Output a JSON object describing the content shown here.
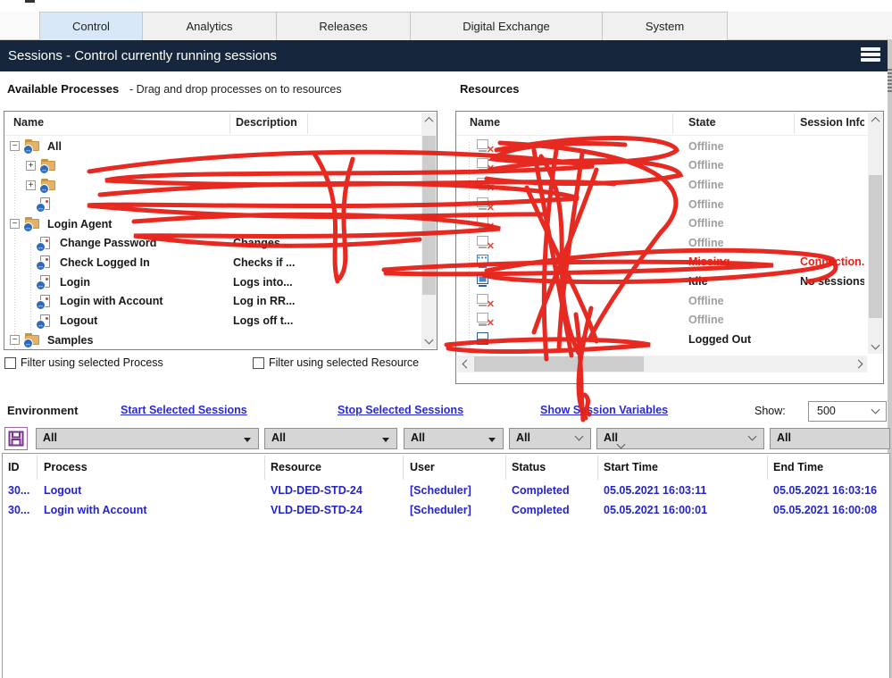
{
  "colors": {
    "header_navy": "#16263c",
    "tab_selected": "#d9e8f8",
    "link_blue": "#2a2ad4",
    "row_blue": "#2424c8",
    "missing_red": "#e62117",
    "offline_gray": "#9f9f9f",
    "scribble_red": "#e51f16"
  },
  "tabs": {
    "items": [
      {
        "label": "Control",
        "active": true
      },
      {
        "label": "Analytics",
        "active": false
      },
      {
        "label": "Releases",
        "active": false
      },
      {
        "label": "Digital Exchange",
        "active": false
      },
      {
        "label": "System",
        "active": false
      }
    ]
  },
  "header": {
    "title": "Sessions - Control currently running sessions",
    "menu_icon": "hamburger-icon"
  },
  "available_processes": {
    "title": "Available Processes",
    "hint": "- Drag and drop processes on to resources",
    "columns": [
      "Name",
      "Description"
    ],
    "rows": [
      {
        "name": "All",
        "desc": "",
        "redacted": false
      },
      {
        "name": "",
        "desc": "",
        "redacted": true
      },
      {
        "name": "",
        "desc": "",
        "redacted": true
      },
      {
        "name": "",
        "desc": "",
        "redacted": true
      },
      {
        "name": "Login Agent",
        "desc": "",
        "redacted": false
      },
      {
        "name": "Change Password",
        "desc": "Changes ...",
        "redacted": false
      },
      {
        "name": "Check Logged In",
        "desc": "Checks if ...",
        "redacted": false
      },
      {
        "name": "Login",
        "desc": "Logs into...",
        "redacted": false
      },
      {
        "name": "Login with Account",
        "desc": "Log in RR...",
        "redacted": false
      },
      {
        "name": "Logout",
        "desc": "Logs off t...",
        "redacted": false
      },
      {
        "name": "Samples",
        "desc": "",
        "redacted": false
      }
    ]
  },
  "resources": {
    "title": "Resources",
    "columns": [
      "Name",
      "State",
      "Session Info"
    ],
    "rows": [
      {
        "name": "",
        "state": "Offline",
        "session": "",
        "redacted": true
      },
      {
        "name": "",
        "state": "Offline",
        "session": "",
        "redacted": true
      },
      {
        "name": "",
        "state": "Offline",
        "session": "",
        "redacted": true
      },
      {
        "name": "",
        "state": "Offline",
        "session": "",
        "redacted": true
      },
      {
        "name": "",
        "state": "Offline",
        "session": "",
        "redacted": true
      },
      {
        "name": "",
        "state": "Offline",
        "session": "",
        "redacted": true
      },
      {
        "name": "",
        "state": "Missing",
        "session": "Connection...",
        "redacted": true
      },
      {
        "name": "",
        "state": "Idle",
        "session": "No sessions",
        "redacted": true
      },
      {
        "name": "",
        "state": "Offline",
        "session": "",
        "redacted": true
      },
      {
        "name": "",
        "state": "Offline",
        "session": "",
        "redacted": true
      },
      {
        "name": "",
        "state": "Logged Out",
        "session": "",
        "redacted": true
      }
    ]
  },
  "filter_checkboxes": {
    "process_label": "Filter using selected Process",
    "resource_label": "Filter using selected Resource"
  },
  "environment": {
    "label": "Environment",
    "links": [
      "Start Selected Sessions",
      "Stop Selected Sessions",
      "Show Session Variables"
    ],
    "show_label": "Show:",
    "show_value": "500"
  },
  "filter_row": {
    "save_icon": "save-icon",
    "dropdowns": [
      "All",
      "All",
      "All",
      "All",
      "All",
      "All"
    ]
  },
  "session_table": {
    "columns": [
      "ID",
      "Process",
      "Resource",
      "User",
      "Status",
      "Start Time",
      "End Time"
    ],
    "rows": [
      {
        "id": "30...",
        "process": "Logout",
        "resource": "VLD-DED-STD-24",
        "user": "[Scheduler]",
        "status": "Completed",
        "start": "05.05.2021 16:03:11",
        "end": "05.05.2021 16:03:16"
      },
      {
        "id": "30...",
        "process": "Login with Account",
        "resource": "VLD-DED-STD-24",
        "user": "[Scheduler]",
        "status": "Completed",
        "start": "05.05.2021 16:00:01",
        "end": "05.05.2021 16:00:08"
      }
    ]
  }
}
